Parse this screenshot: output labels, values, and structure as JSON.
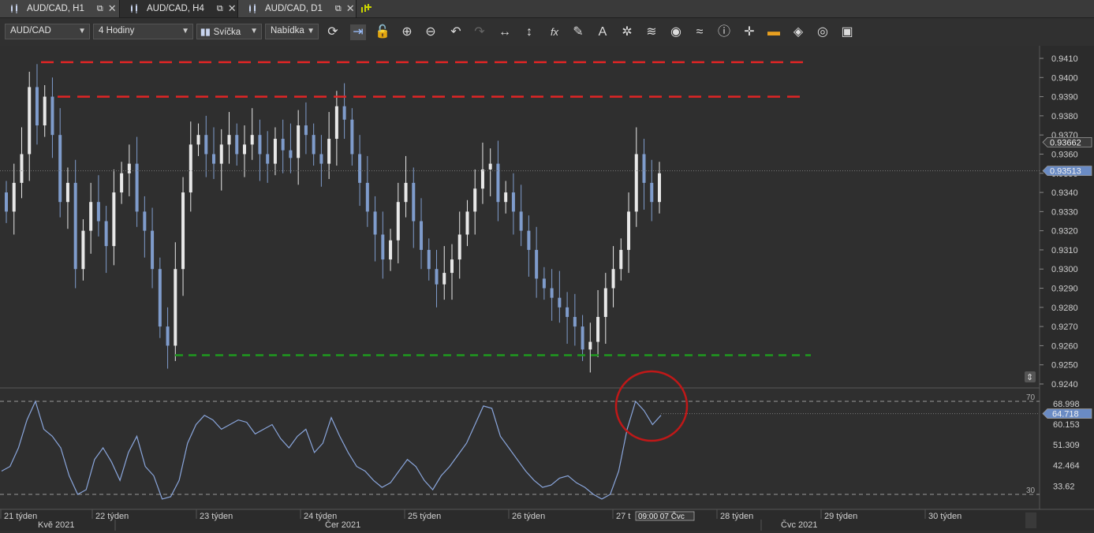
{
  "tabs": [
    {
      "label": "AUD/CAD, H1",
      "active": false
    },
    {
      "label": "AUD/CAD, H4",
      "active": true
    },
    {
      "label": "AUD/CAD, D1",
      "active": false
    }
  ],
  "toolbar": {
    "symbol": "AUD/CAD",
    "timeframe": "4 Hodiny",
    "chart_type": "Svíčka",
    "price_side": "Nabídka",
    "tools": [
      "refresh-icon",
      "autoscroll-icon",
      "unlock-icon",
      "zoom-in-icon",
      "zoom-out-icon",
      "undo-icon",
      "redo-icon",
      "horizontal-scale-icon",
      "vertical-scale-icon",
      "fx-icon",
      "pencil-icon",
      "text-icon",
      "crosshair-tool-icon",
      "layers-icon",
      "eye-icon",
      "chart-style-icon",
      "info-icon",
      "crosshair-icon",
      "color-bar-icon",
      "paint-bucket-icon",
      "settings-ring-icon",
      "save-icon"
    ]
  },
  "price_axis": {
    "ticks": [
      "0.9410",
      "0.9400",
      "0.9390",
      "0.9380",
      "0.9370",
      "0.9360",
      "0.9350",
      "0.9340",
      "0.9330",
      "0.9320",
      "0.9310",
      "0.9300",
      "0.9290",
      "0.9280",
      "0.9270",
      "0.9260",
      "0.9250",
      "0.9240"
    ],
    "current_labels": [
      "0.93662",
      "0.93513"
    ]
  },
  "rsi_axis": {
    "level_labels": [
      "70",
      "30"
    ],
    "ticks": [
      "68.998",
      "60.153",
      "51.309",
      "42.464",
      "33.62"
    ],
    "current_label": "64.718"
  },
  "time_axis": {
    "weeks": [
      "21 týden",
      "22 týden",
      "23 týden",
      "24 týden",
      "25 týden",
      "26 týden",
      "27 t",
      "28 týden",
      "29 týden",
      "30 týden"
    ],
    "months": [
      "Kvě 2021",
      "Čer 2021",
      "Čvc 2021"
    ],
    "cursor_label": "09:00 07 Čvc"
  },
  "colors": {
    "resistance": "#e02525",
    "support": "#1f9a1f",
    "bull_candle": "#e8e8e8",
    "bear_candle": "#7f9ccc",
    "rsi_line": "#8aa6dc",
    "highlight_circle": "#c01818",
    "current_price_label": "#6a8bc4"
  },
  "chart_data": {
    "type": "candlestick",
    "title": "",
    "price_range": [
      0.924,
      0.941
    ],
    "levels": {
      "resistance": [
        0.9408,
        0.939
      ],
      "support": [
        0.9255
      ]
    },
    "current_price": 0.93513,
    "closes": [
      0.933,
      0.9345,
      0.936,
      0.9395,
      0.9375,
      0.939,
      0.937,
      0.9335,
      0.9345,
      0.93,
      0.932,
      0.9335,
      0.9325,
      0.9312,
      0.934,
      0.935,
      0.9355,
      0.933,
      0.932,
      0.93,
      0.927,
      0.926,
      0.93,
      0.934,
      0.9365,
      0.937,
      0.936,
      0.9355,
      0.9365,
      0.937,
      0.936,
      0.9365,
      0.937,
      0.936,
      0.9355,
      0.9368,
      0.9362,
      0.9358,
      0.9375,
      0.937,
      0.936,
      0.9355,
      0.9368,
      0.9385,
      0.9378,
      0.936,
      0.9345,
      0.933,
      0.9318,
      0.9305,
      0.9315,
      0.9335,
      0.9345,
      0.9325,
      0.931,
      0.93,
      0.9292,
      0.9298,
      0.9305,
      0.9318,
      0.933,
      0.9342,
      0.9352,
      0.9355,
      0.9335,
      0.934,
      0.933,
      0.932,
      0.931,
      0.9295,
      0.929,
      0.9285,
      0.928,
      0.9275,
      0.927,
      0.9258,
      0.9262,
      0.9275,
      0.929,
      0.93,
      0.931,
      0.933,
      0.936,
      0.9345,
      0.9335,
      0.935
    ],
    "rsi": {
      "levels": [
        70,
        30
      ],
      "range": [
        27,
        72
      ],
      "current": 64.718,
      "values": [
        40,
        42,
        50,
        62,
        70,
        58,
        55,
        50,
        38,
        30,
        32,
        45,
        50,
        44,
        36,
        48,
        55,
        42,
        38,
        28,
        29,
        36,
        52,
        60,
        64,
        62,
        58,
        60,
        62,
        61,
        56,
        58,
        60,
        54,
        50,
        55,
        58,
        48,
        52,
        63,
        55,
        48,
        42,
        40,
        36,
        33,
        35,
        40,
        45,
        42,
        36,
        32,
        38,
        42,
        47,
        52,
        60,
        68,
        67,
        55,
        50,
        45,
        40,
        36,
        33,
        34,
        37,
        38,
        35,
        33,
        30,
        28,
        30,
        40,
        58,
        70,
        66,
        60,
        64
      ],
      "labels": [
        "68.998",
        "60.153",
        "51.309",
        "42.464",
        "33.62"
      ]
    }
  }
}
